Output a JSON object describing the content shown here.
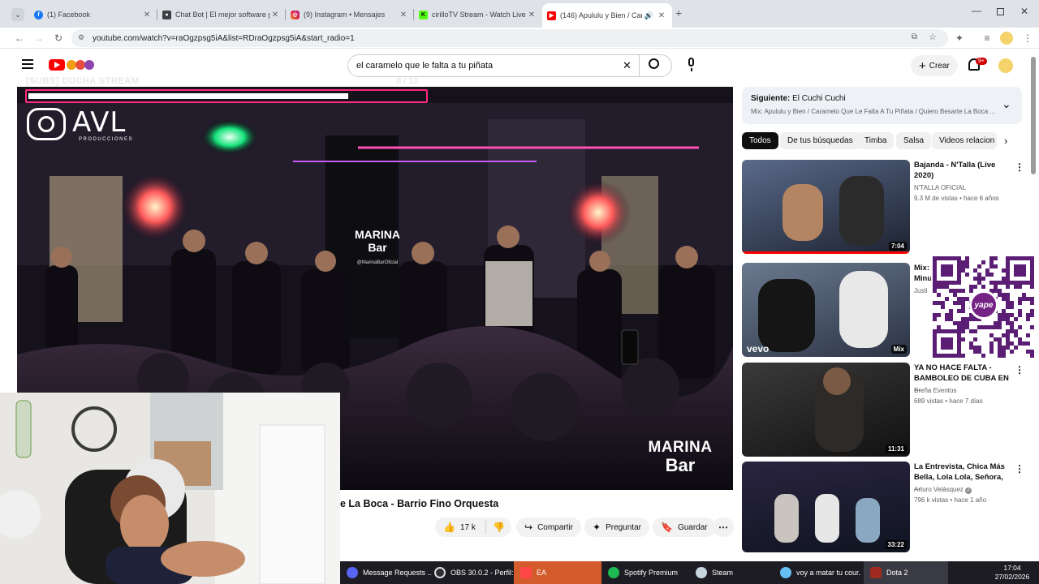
{
  "browser": {
    "tabs": [
      {
        "title": "(1) Facebook",
        "icon": "facebook-icon",
        "color": "#1877f2"
      },
      {
        "title": "Chat Bot | El mejor software pa",
        "icon": "chatbot-icon",
        "color": "#3c4043"
      },
      {
        "title": "(9) Instagram • Mensajes",
        "icon": "instagram-icon",
        "color": "#d6249f"
      },
      {
        "title": "cirilloTV Stream - Watch Live o",
        "icon": "kick-icon",
        "color": "#53fc18"
      },
      {
        "title": "(146) Apululu y Bien / Cara",
        "icon": "youtube-icon",
        "color": "#ff0000"
      }
    ],
    "url": "youtube.com/watch?v=raOgzpsg5iA&list=RDraOgzpsg5iA&start_radio=1"
  },
  "youtube": {
    "search_value": "el caramelo que le falta a tu piñata",
    "create_label": "Crear",
    "notif_count": "9+"
  },
  "video": {
    "overlay_top": "[SUBS] DUCHA STREAM",
    "overlay_count": "8 / 10",
    "logo_text": "AVL",
    "logo_sub": "PRODUCCIONES",
    "venue_sign": "MARINA Bar",
    "venue_handle": "@MarinaBarOficial",
    "watermark_line1": "MARINA",
    "watermark_line2": "Bar",
    "title_partial": "e La Boca - Barrio Fino Orquesta",
    "likes": "17 k",
    "share_label": "Compartir",
    "ask_label": "Preguntar",
    "save_label": "Guardar"
  },
  "up_next": {
    "label": "Siguiente:",
    "title": "El Cuchi Cuchi",
    "mix": "Mix: Apululu y Bien / Caramelo Que Le Falta A Tu Piñata / Quiero Besarte La Boca ..."
  },
  "chips": [
    "Todos",
    "De tus búsquedas",
    "Timba",
    "Salsa",
    "Videos relacion"
  ],
  "recommendations": [
    {
      "title": "Bajanda - N'Talla (Live 2020)",
      "channel": "N'TALLA OFICIAL",
      "meta": "9.3 M de vistas • hace 6 años",
      "duration": "7:04",
      "verified": false
    },
    {
      "title": "Mix: Minu",
      "channel": "Justi",
      "meta": "",
      "duration": "Mix",
      "verified": false
    },
    {
      "title": "YA NO HACE FALTA - BAMBOLEO DE CUBA EN ...",
      "channel": "Breña Eventos",
      "meta": "689 vistas • hace 7 días",
      "duration": "11:31",
      "verified": false
    },
    {
      "title": "La Entrevista, Chica Más Bella, Lola Lola, Señora, ...",
      "channel": "Arturo Velásquez",
      "meta": "796 k vistas • hace 1 año",
      "duration": "33:22",
      "verified": true
    }
  ],
  "qr": {
    "brand": "yape"
  },
  "vevo": "vevo",
  "taskbar": {
    "items": [
      {
        "label": "Message Requests ...",
        "color": "#5865f2"
      },
      {
        "label": "OBS 30.0.2 - Perfil: ...",
        "color": "#302e31"
      },
      {
        "label": "EA",
        "color": "#ff4747"
      },
      {
        "label": "Spotify Premium",
        "color": "#1db954"
      },
      {
        "label": "Steam",
        "color": "#1b2838"
      },
      {
        "label": "voy a matar tu cour...",
        "color": "#2a475e"
      },
      {
        "label": "Dota 2",
        "color": "#a02a1f"
      }
    ],
    "time": "17:04",
    "date": "27/02/2026"
  },
  "colors": {
    "accent": "#ff0000",
    "chrome_strip": "#dfe3e8"
  }
}
